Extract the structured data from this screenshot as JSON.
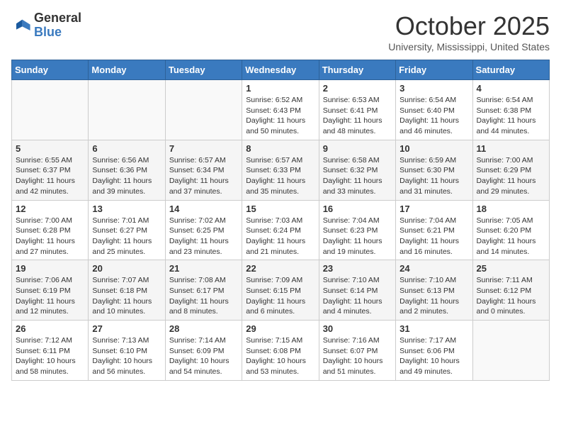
{
  "logo": {
    "general": "General",
    "blue": "Blue"
  },
  "title": "October 2025",
  "subtitle": "University, Mississippi, United States",
  "days_of_week": [
    "Sunday",
    "Monday",
    "Tuesday",
    "Wednesday",
    "Thursday",
    "Friday",
    "Saturday"
  ],
  "weeks": [
    [
      {
        "day": "",
        "info": ""
      },
      {
        "day": "",
        "info": ""
      },
      {
        "day": "",
        "info": ""
      },
      {
        "day": "1",
        "info": "Sunrise: 6:52 AM\nSunset: 6:43 PM\nDaylight: 11 hours and 50 minutes."
      },
      {
        "day": "2",
        "info": "Sunrise: 6:53 AM\nSunset: 6:41 PM\nDaylight: 11 hours and 48 minutes."
      },
      {
        "day": "3",
        "info": "Sunrise: 6:54 AM\nSunset: 6:40 PM\nDaylight: 11 hours and 46 minutes."
      },
      {
        "day": "4",
        "info": "Sunrise: 6:54 AM\nSunset: 6:38 PM\nDaylight: 11 hours and 44 minutes."
      }
    ],
    [
      {
        "day": "5",
        "info": "Sunrise: 6:55 AM\nSunset: 6:37 PM\nDaylight: 11 hours and 42 minutes."
      },
      {
        "day": "6",
        "info": "Sunrise: 6:56 AM\nSunset: 6:36 PM\nDaylight: 11 hours and 39 minutes."
      },
      {
        "day": "7",
        "info": "Sunrise: 6:57 AM\nSunset: 6:34 PM\nDaylight: 11 hours and 37 minutes."
      },
      {
        "day": "8",
        "info": "Sunrise: 6:57 AM\nSunset: 6:33 PM\nDaylight: 11 hours and 35 minutes."
      },
      {
        "day": "9",
        "info": "Sunrise: 6:58 AM\nSunset: 6:32 PM\nDaylight: 11 hours and 33 minutes."
      },
      {
        "day": "10",
        "info": "Sunrise: 6:59 AM\nSunset: 6:30 PM\nDaylight: 11 hours and 31 minutes."
      },
      {
        "day": "11",
        "info": "Sunrise: 7:00 AM\nSunset: 6:29 PM\nDaylight: 11 hours and 29 minutes."
      }
    ],
    [
      {
        "day": "12",
        "info": "Sunrise: 7:00 AM\nSunset: 6:28 PM\nDaylight: 11 hours and 27 minutes."
      },
      {
        "day": "13",
        "info": "Sunrise: 7:01 AM\nSunset: 6:27 PM\nDaylight: 11 hours and 25 minutes."
      },
      {
        "day": "14",
        "info": "Sunrise: 7:02 AM\nSunset: 6:25 PM\nDaylight: 11 hours and 23 minutes."
      },
      {
        "day": "15",
        "info": "Sunrise: 7:03 AM\nSunset: 6:24 PM\nDaylight: 11 hours and 21 minutes."
      },
      {
        "day": "16",
        "info": "Sunrise: 7:04 AM\nSunset: 6:23 PM\nDaylight: 11 hours and 19 minutes."
      },
      {
        "day": "17",
        "info": "Sunrise: 7:04 AM\nSunset: 6:21 PM\nDaylight: 11 hours and 16 minutes."
      },
      {
        "day": "18",
        "info": "Sunrise: 7:05 AM\nSunset: 6:20 PM\nDaylight: 11 hours and 14 minutes."
      }
    ],
    [
      {
        "day": "19",
        "info": "Sunrise: 7:06 AM\nSunset: 6:19 PM\nDaylight: 11 hours and 12 minutes."
      },
      {
        "day": "20",
        "info": "Sunrise: 7:07 AM\nSunset: 6:18 PM\nDaylight: 11 hours and 10 minutes."
      },
      {
        "day": "21",
        "info": "Sunrise: 7:08 AM\nSunset: 6:17 PM\nDaylight: 11 hours and 8 minutes."
      },
      {
        "day": "22",
        "info": "Sunrise: 7:09 AM\nSunset: 6:15 PM\nDaylight: 11 hours and 6 minutes."
      },
      {
        "day": "23",
        "info": "Sunrise: 7:10 AM\nSunset: 6:14 PM\nDaylight: 11 hours and 4 minutes."
      },
      {
        "day": "24",
        "info": "Sunrise: 7:10 AM\nSunset: 6:13 PM\nDaylight: 11 hours and 2 minutes."
      },
      {
        "day": "25",
        "info": "Sunrise: 7:11 AM\nSunset: 6:12 PM\nDaylight: 11 hours and 0 minutes."
      }
    ],
    [
      {
        "day": "26",
        "info": "Sunrise: 7:12 AM\nSunset: 6:11 PM\nDaylight: 10 hours and 58 minutes."
      },
      {
        "day": "27",
        "info": "Sunrise: 7:13 AM\nSunset: 6:10 PM\nDaylight: 10 hours and 56 minutes."
      },
      {
        "day": "28",
        "info": "Sunrise: 7:14 AM\nSunset: 6:09 PM\nDaylight: 10 hours and 54 minutes."
      },
      {
        "day": "29",
        "info": "Sunrise: 7:15 AM\nSunset: 6:08 PM\nDaylight: 10 hours and 53 minutes."
      },
      {
        "day": "30",
        "info": "Sunrise: 7:16 AM\nSunset: 6:07 PM\nDaylight: 10 hours and 51 minutes."
      },
      {
        "day": "31",
        "info": "Sunrise: 7:17 AM\nSunset: 6:06 PM\nDaylight: 10 hours and 49 minutes."
      },
      {
        "day": "",
        "info": ""
      }
    ]
  ]
}
